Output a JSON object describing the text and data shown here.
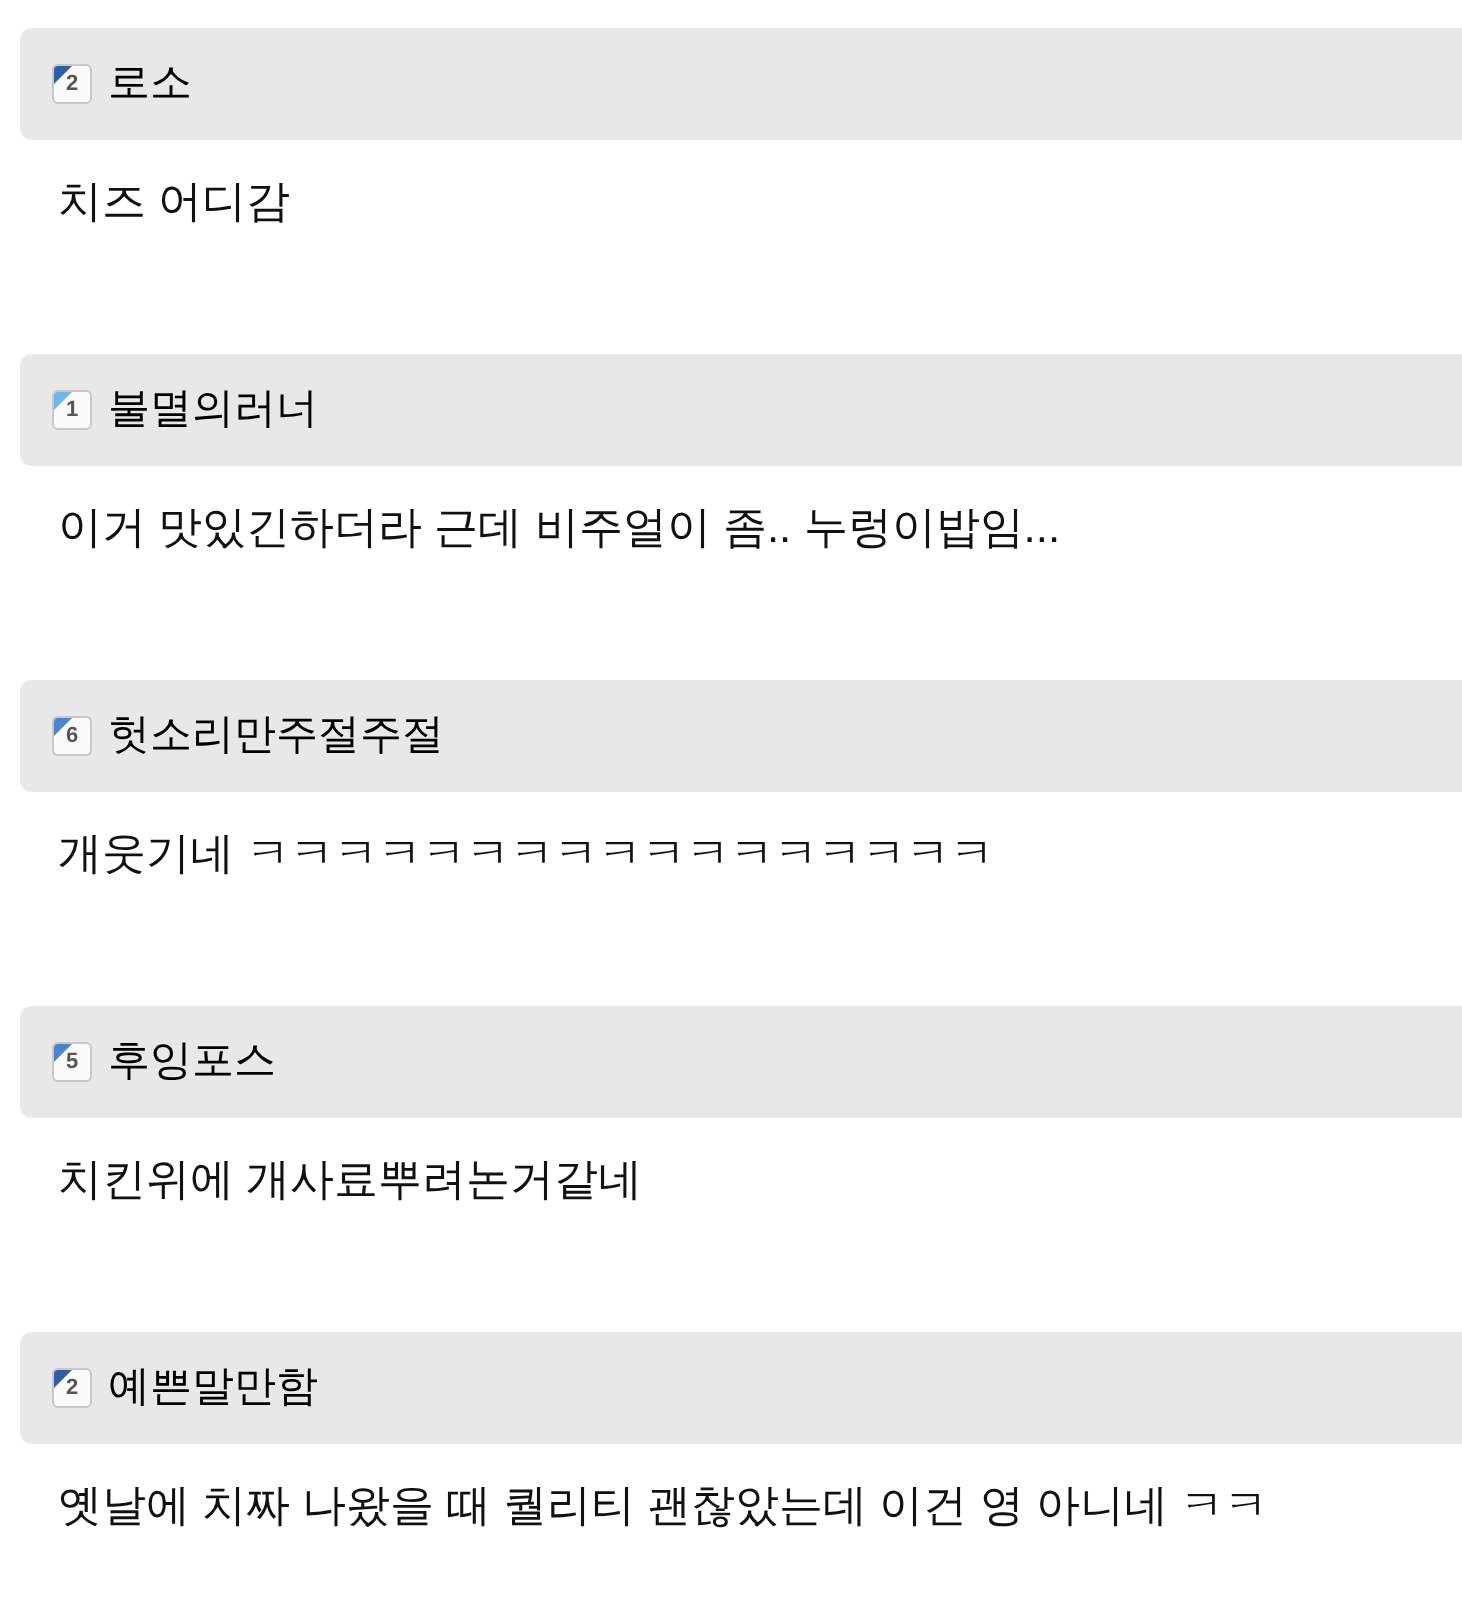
{
  "comments": [
    {
      "level": "2",
      "color": "#2f5fa8",
      "author": "로소",
      "text": "치즈 어디감"
    },
    {
      "level": "1",
      "color": "#6ab8ec",
      "author": "불멸의러너",
      "text": "이거 맛있긴하더라 근데 비주얼이 좀.. 누렁이밥임..."
    },
    {
      "level": "6",
      "color": "#4a86d0",
      "author": "헛소리만주절주절",
      "text": "개웃기네 ㅋㅋㅋㅋㅋㅋㅋㅋㅋㅋㅋㅋㅋㅋㅋㅋㅋ"
    },
    {
      "level": "5",
      "color": "#4a86d0",
      "author": "후잉포스",
      "text": "치킨위에 개사료뿌려논거같네"
    },
    {
      "level": "2",
      "color": "#2f5fa8",
      "author": "예쁜말만함",
      "text": "옛날에 치짜 나왔을 때 퀄리티 괜찮았는데 이건 영 아니네 ㅋㅋ"
    }
  ]
}
